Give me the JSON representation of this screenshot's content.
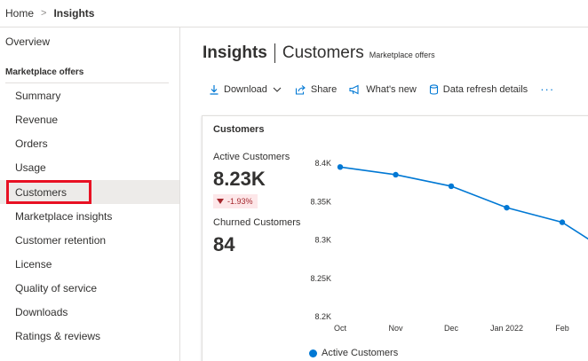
{
  "breadcrumb": {
    "home": "Home",
    "separator": ">",
    "current": "Insights"
  },
  "sidebar": {
    "overview": "Overview",
    "group_title": "Marketplace offers",
    "items": [
      {
        "label": "Summary"
      },
      {
        "label": "Revenue"
      },
      {
        "label": "Orders"
      },
      {
        "label": "Usage"
      },
      {
        "label": "Customers",
        "selected": true
      },
      {
        "label": "Marketplace insights"
      },
      {
        "label": "Customer retention"
      },
      {
        "label": "License"
      },
      {
        "label": "Quality of service"
      },
      {
        "label": "Downloads"
      },
      {
        "label": "Ratings & reviews"
      }
    ]
  },
  "header": {
    "title": "Insights",
    "subtitle": "Customers",
    "tag": "Marketplace offers"
  },
  "toolbar": {
    "download": "Download",
    "share": "Share",
    "whats_new": "What's new",
    "data_refresh": "Data refresh details",
    "more": "···"
  },
  "card": {
    "title": "Customers",
    "active_label": "Active Customers",
    "active_value": "8.23K",
    "active_delta": "-1.93%",
    "churned_label": "Churned Customers",
    "churned_value": "84"
  },
  "colors": {
    "accent": "#0078d4",
    "negative": "#a4262c",
    "negative_bg": "#fde7e9",
    "highlight": "#e81123"
  },
  "chart_data": {
    "type": "line",
    "categories": [
      "Oct",
      "Nov",
      "Dec",
      "Jan 2022",
      "Feb"
    ],
    "series": [
      {
        "name": "Active Customers",
        "values": [
          8395,
          8385,
          8370,
          8342,
          8323
        ]
      }
    ],
    "yticks": [
      "8.4K",
      "8.35K",
      "8.3K",
      "8.25K",
      "8.2K"
    ],
    "ylim": [
      8200,
      8400
    ],
    "grid": false,
    "legend": "bottom"
  }
}
